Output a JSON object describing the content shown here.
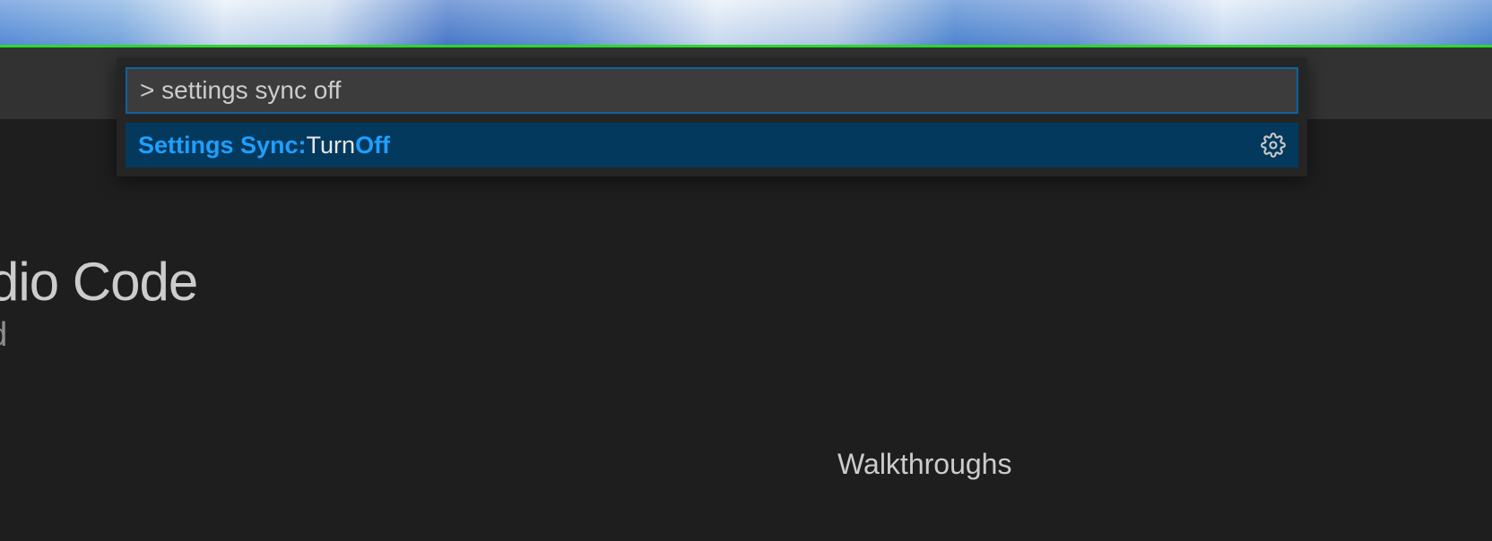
{
  "command_palette": {
    "input_value": "> settings sync off",
    "result": {
      "prefix_highlight": "Settings Sync:",
      "middle_text": " Turn ",
      "suffix_highlight": "Off"
    }
  },
  "welcome": {
    "title": "tudio Code",
    "subtitle": "lved"
  },
  "sidebar_section": {
    "walkthroughs": "Walkthroughs"
  }
}
